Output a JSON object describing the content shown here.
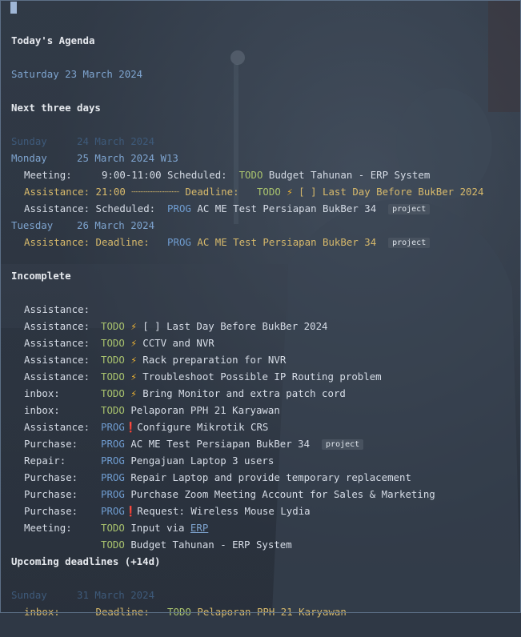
{
  "agenda": {
    "title": "Today's Agenda",
    "today": "Saturday 23 March 2024",
    "next_days_title": "Next three days",
    "sunday": "Sunday     24 March 2024",
    "monday": "Monday     25 March 2024 W13",
    "monday_items": [
      {
        "prefix": "Meeting:     9:00-11:00 Scheduled:  ",
        "kw": "TODO",
        "text": "Budget Tahunan - ERP System"
      },
      {
        "prefix": "Assistance: 21:00 ┈┈┈┈┈┈┈┈ Deadline:   ",
        "kw": "TODO",
        "glyph": "⚡",
        "text": " [ ] Last Day Before BukBer 2024"
      },
      {
        "prefix": "Assistance: Scheduled:  ",
        "kw": "PROG",
        "text": "AC ME Test Persiapan BukBer 34",
        "tag": "project"
      }
    ],
    "tuesday": "Tuesday    26 March 2024",
    "tuesday_items": [
      {
        "prefix": "Assistance: Deadline:   ",
        "kw": "PROG",
        "text": "AC ME Test Persiapan BukBer 34",
        "tag": "project"
      }
    ],
    "incomplete_title": "Incomplete",
    "incomplete": [
      {
        "category": "Assistance:",
        "kw": "TODO",
        "glyph": "⚡",
        "text": "[ ] Last Day Before BukBer 2024"
      },
      {
        "category": "Assistance:",
        "kw": "TODO",
        "glyph": "⚡",
        "text": "CCTV and NVR"
      },
      {
        "category": "Assistance:",
        "kw": "TODO",
        "glyph": "⚡",
        "text": "Rack preparation for NVR"
      },
      {
        "category": "Assistance:",
        "kw": "TODO",
        "glyph": "⚡",
        "text": "Troubleshoot Possible IP Routing problem"
      },
      {
        "category": "Assistance:",
        "kw": "TODO",
        "glyph": "⚡",
        "text": "Bring Monitor and extra patch cord"
      },
      {
        "category": "inbox:",
        "kw": "TODO",
        "text": "Pelaporan PPH 21 Karyawan"
      },
      {
        "category": "inbox:",
        "kw": "PROG",
        "glyph": "❗",
        "text": "Configure Mikrotik CRS"
      },
      {
        "category": "Assistance:",
        "kw": "PROG",
        "text": "AC ME Test Persiapan BukBer 34",
        "tag": "project"
      },
      {
        "category": "Purchase:",
        "kw": "PROG",
        "text": "Pengajuan Laptop 3 users"
      },
      {
        "category": "Repair:",
        "kw": "PROG",
        "text": "Repair Laptop and provide temporary replacement"
      },
      {
        "category": "Purchase:",
        "kw": "PROG",
        "text": "Purchase Zoom Meeting Account for Sales & Marketing"
      },
      {
        "category": "Purchase:",
        "kw": "PROG",
        "glyph": "❗",
        "text": "Request: Wireless Mouse Lydia"
      },
      {
        "category": "Purchase:",
        "kw": "TODO",
        "text": "Input via ",
        "link": "ERP"
      },
      {
        "category": "Meeting:",
        "kw": "TODO",
        "text": "Budget Tahunan - ERP System"
      }
    ],
    "upcoming_title": "Upcoming deadlines (+14d)",
    "upcoming_date": "Sunday     31 March 2024",
    "upcoming": [
      {
        "prefix": "inbox:      Deadline:   ",
        "kw": "TODO",
        "text": "Pelaporan PPH 21 Karyawan"
      }
    ]
  },
  "colors": {
    "background": "#2f3845",
    "text": "#d6dce6",
    "date": "#7ea4cf",
    "todo": "#a9c36e",
    "prog": "#6f9cd0",
    "deadline": "#d7b96b",
    "bolt": "#f2b632",
    "urgent": "#e05252"
  }
}
